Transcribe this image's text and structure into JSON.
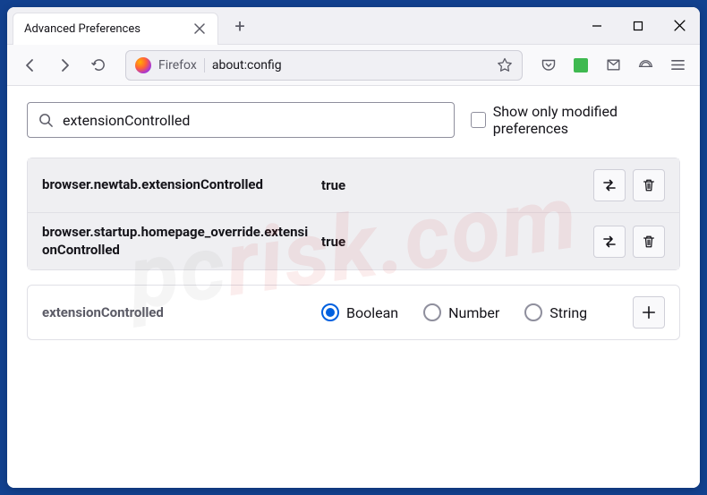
{
  "window": {
    "tab_title": "Advanced Preferences"
  },
  "toolbar": {
    "identity_label": "Firefox",
    "url": "about:config"
  },
  "search": {
    "value": "extensionControlled",
    "checkbox_label": "Show only modified preferences"
  },
  "prefs": [
    {
      "name": "browser.newtab.extensionControlled",
      "value": "true"
    },
    {
      "name": "browser.startup.homepage_override.extensionControlled",
      "value": "true"
    }
  ],
  "new_pref": {
    "name": "extensionControlled",
    "types": [
      "Boolean",
      "Number",
      "String"
    ],
    "selected": 0
  },
  "watermark": {
    "p1": "pc",
    "p2": "risk.com"
  }
}
